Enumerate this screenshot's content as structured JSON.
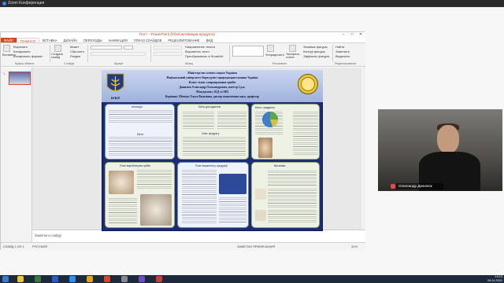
{
  "zoom": {
    "title": "Zoom Конференция"
  },
  "powerpoint": {
    "title": "Пост – PowerPoint (Сбой активации продукта)",
    "window_buttons": {
      "min": "–",
      "max": "□",
      "close": "✕"
    },
    "tabs": [
      "ФАЙЛ",
      "ГЛАВНАЯ",
      "ВСТАВКА",
      "ДИЗАЙН",
      "ПЕРЕХОДЫ",
      "АНИМАЦИЯ",
      "ПОКАЗ СЛАЙДОВ",
      "РЕЦЕНЗИРОВАНИЕ",
      "ВИД"
    ],
    "ribbon": {
      "paste": "Вставить",
      "cut": "Вырезать",
      "copy": "Копировать",
      "format_copy": "Копировать формат",
      "new_slide": "Создать слайд",
      "layout": "Макет",
      "reset": "Сбросить",
      "section": "Раздел",
      "text_direction": "Направление текста",
      "align_text": "Выровнять текст",
      "smartart": "Преобразовать в SmartArt",
      "arrange": "Упорядочить",
      "quick_styles": "Экспресс-стили",
      "shape_fill": "Заливка фигуры",
      "shape_outline": "Контур фигуры",
      "shape_effects": "Эффекты фигуры",
      "find": "Найти",
      "replace": "Заменить",
      "select": "Выделить"
    },
    "groups": [
      "Буфер обмена",
      "Слайды",
      "Шрифт",
      "Абзац",
      "Рисование",
      "Редактирование"
    ],
    "notes_placeholder": "Заметки к слайду",
    "status_left": "СЛАЙД 1 ИЗ 1",
    "status_lang": "РУССКИЙ",
    "status_right": "ЗАМЕТКИ   ПРИМЕЧАНИЯ",
    "zoom_level": "31%",
    "slide_number": "1"
  },
  "poster": {
    "logo_label": "НУБІП",
    "header_lines": [
      "Міністерство освіти і науки України",
      "Національний університет біоресурсів і природокористування України",
      "Бізнес-план з вирощування грибів",
      "Данилюк Олександр Олександрович, магістр 2 р.н.",
      "Менеджмент, ЗЕД та МП",
      "Керівник: Шевчук Ольга Василівна, доктор економічних наук, професор"
    ],
    "panel_titles": [
      "Анотація",
      "Мета",
      "Мета дослідження",
      "Опис продукту",
      "Мета і завдання",
      "Опис продукту",
      "План виробництва грибів",
      "План маркетингу продукції",
      "Фінансовий план",
      "Висновки"
    ]
  },
  "participant": {
    "name": "Олександр Данилюк"
  },
  "taskbar": {
    "time": "19:13",
    "date": "06.11.2021"
  },
  "colors": {
    "accent": "#d24726",
    "poster_bg": "#1d2d73"
  }
}
